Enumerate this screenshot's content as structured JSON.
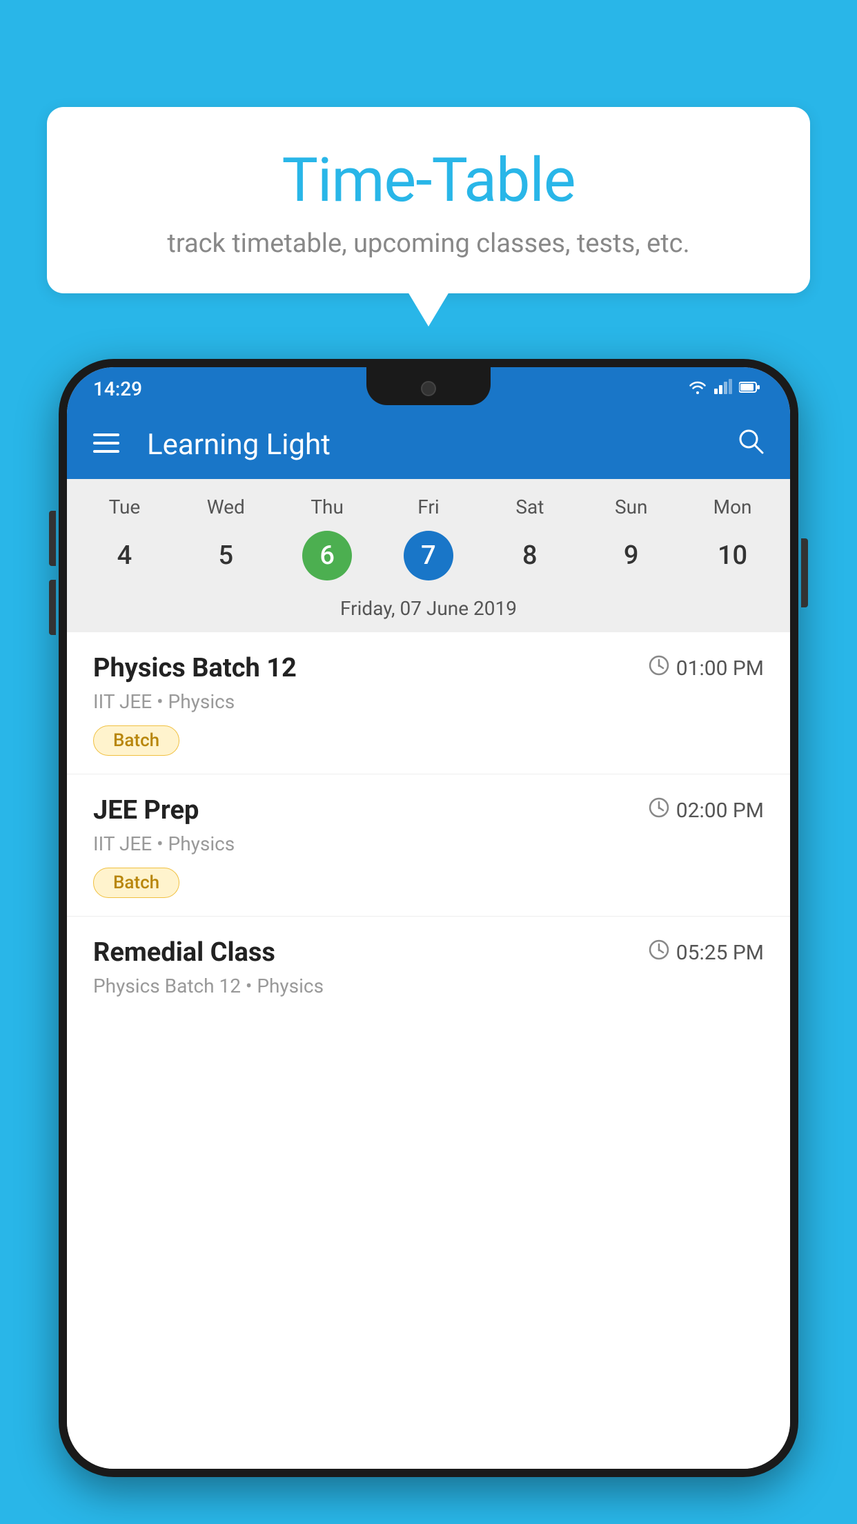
{
  "background": {
    "color": "#29b6e8"
  },
  "speech_bubble": {
    "title": "Time-Table",
    "subtitle": "track timetable, upcoming classes, tests, etc."
  },
  "phone": {
    "status_bar": {
      "time": "14:29"
    },
    "app_bar": {
      "title": "Learning Light"
    },
    "calendar": {
      "days": [
        {
          "label": "Tue",
          "num": "4"
        },
        {
          "label": "Wed",
          "num": "5"
        },
        {
          "label": "Thu",
          "num": "6",
          "state": "today"
        },
        {
          "label": "Fri",
          "num": "7",
          "state": "selected"
        },
        {
          "label": "Sat",
          "num": "8"
        },
        {
          "label": "Sun",
          "num": "9"
        },
        {
          "label": "Mon",
          "num": "10"
        }
      ],
      "selected_date": "Friday, 07 June 2019"
    },
    "schedule": {
      "items": [
        {
          "title": "Physics Batch 12",
          "time": "01:00 PM",
          "subtitle": "IIT JEE • Physics",
          "badge": "Batch"
        },
        {
          "title": "JEE Prep",
          "time": "02:00 PM",
          "subtitle": "IIT JEE • Physics",
          "badge": "Batch"
        },
        {
          "title": "Remedial Class",
          "time": "05:25 PM",
          "subtitle": "Physics Batch 12 • Physics",
          "badge": null
        }
      ]
    }
  }
}
